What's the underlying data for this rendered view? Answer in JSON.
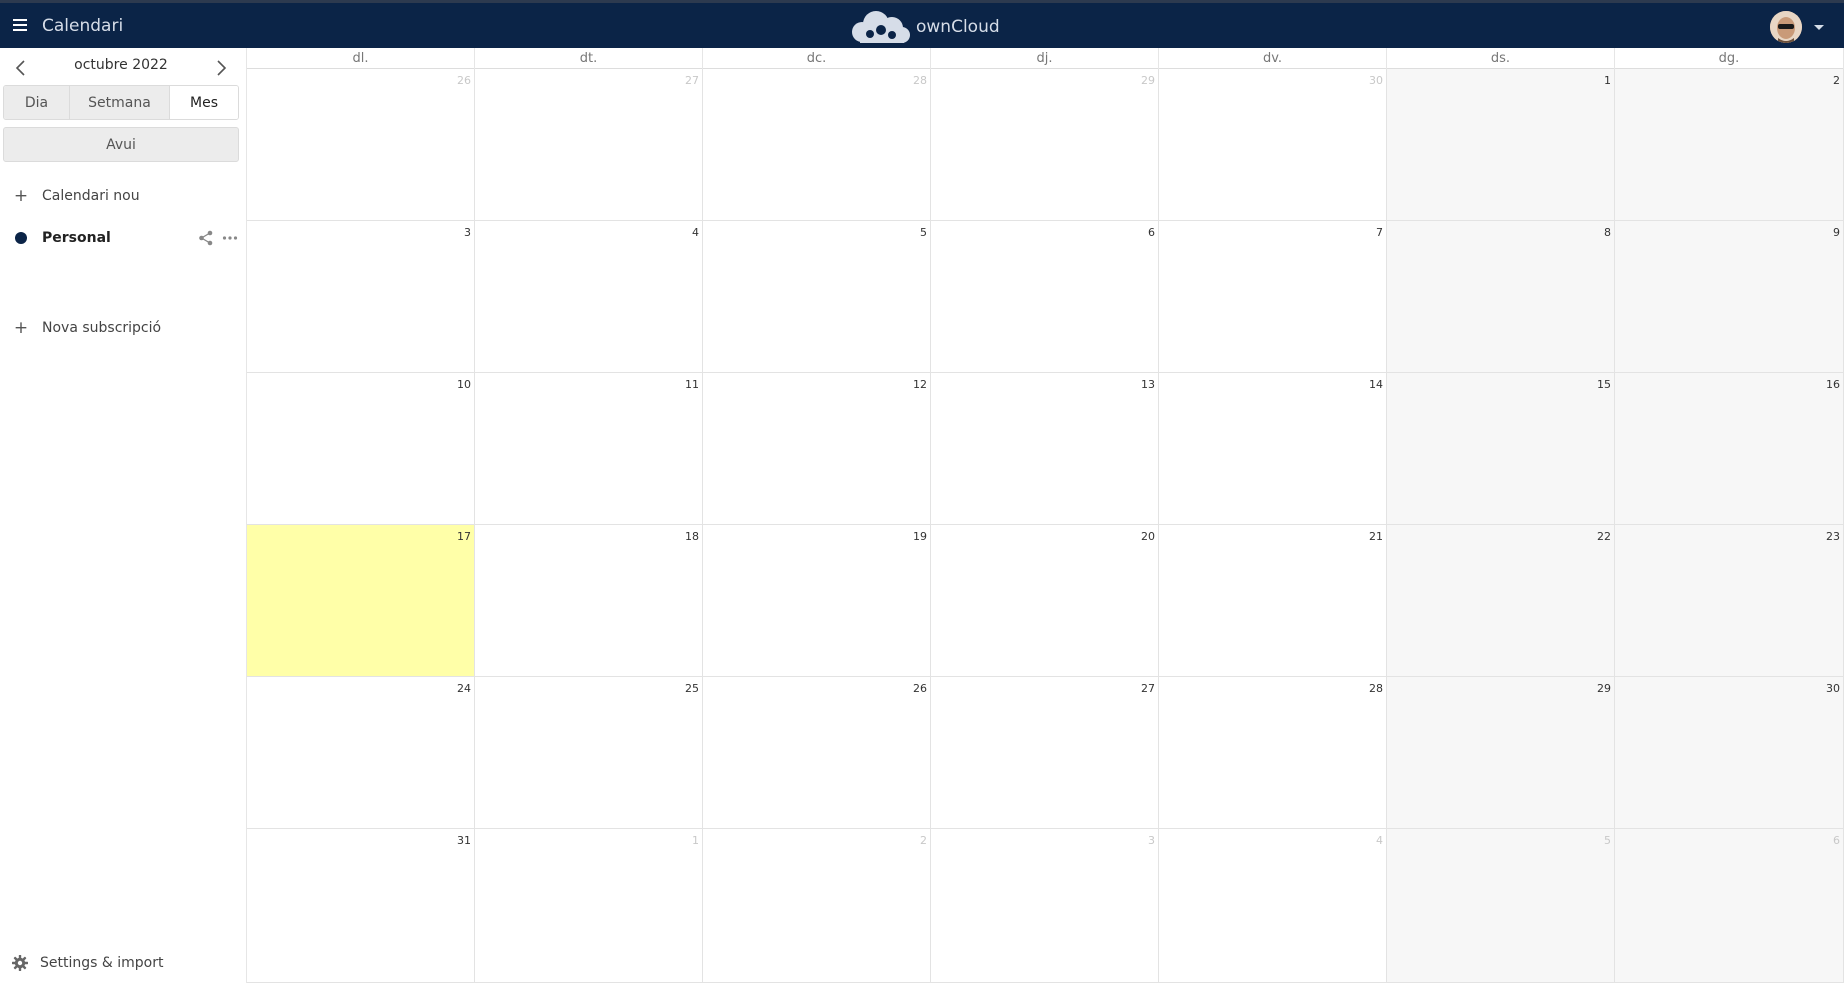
{
  "header": {
    "app_title": "Calendari",
    "brand": "ownCloud",
    "colors": {
      "bar": "#0b2447",
      "text": "#d6dde8"
    }
  },
  "sidebar": {
    "current_month": "octubre 2022",
    "views": [
      "Dia",
      "Setmana",
      "Mes"
    ],
    "active_view": "Mes",
    "today_label": "Avui",
    "new_calendar_label": "Calendari nou",
    "calendars": [
      {
        "name": "Personal",
        "color": "#0b2447"
      }
    ],
    "new_subscription_label": "Nova subscripció",
    "settings_label": "Settings & import"
  },
  "calendar": {
    "weekdays": [
      "dl.",
      "dt.",
      "dc.",
      "dj.",
      "dv.",
      "ds.",
      "dg."
    ],
    "weeks": [
      [
        {
          "d": "26",
          "o": true
        },
        {
          "d": "27",
          "o": true
        },
        {
          "d": "28",
          "o": true
        },
        {
          "d": "29",
          "o": true
        },
        {
          "d": "30",
          "o": true
        },
        {
          "d": "1"
        },
        {
          "d": "2"
        }
      ],
      [
        {
          "d": "3"
        },
        {
          "d": "4"
        },
        {
          "d": "5"
        },
        {
          "d": "6"
        },
        {
          "d": "7"
        },
        {
          "d": "8"
        },
        {
          "d": "9"
        }
      ],
      [
        {
          "d": "10"
        },
        {
          "d": "11"
        },
        {
          "d": "12"
        },
        {
          "d": "13"
        },
        {
          "d": "14"
        },
        {
          "d": "15"
        },
        {
          "d": "16"
        }
      ],
      [
        {
          "d": "17",
          "today": true
        },
        {
          "d": "18"
        },
        {
          "d": "19"
        },
        {
          "d": "20"
        },
        {
          "d": "21"
        },
        {
          "d": "22"
        },
        {
          "d": "23"
        }
      ],
      [
        {
          "d": "24"
        },
        {
          "d": "25"
        },
        {
          "d": "26"
        },
        {
          "d": "27"
        },
        {
          "d": "28"
        },
        {
          "d": "29"
        },
        {
          "d": "30"
        }
      ],
      [
        {
          "d": "31"
        },
        {
          "d": "1",
          "o": true
        },
        {
          "d": "2",
          "o": true
        },
        {
          "d": "3",
          "o": true
        },
        {
          "d": "4",
          "o": true
        },
        {
          "d": "5",
          "o": true
        },
        {
          "d": "6",
          "o": true
        }
      ]
    ],
    "colors": {
      "today": "#ffffa8",
      "weekend": "#f7f7f7"
    }
  }
}
